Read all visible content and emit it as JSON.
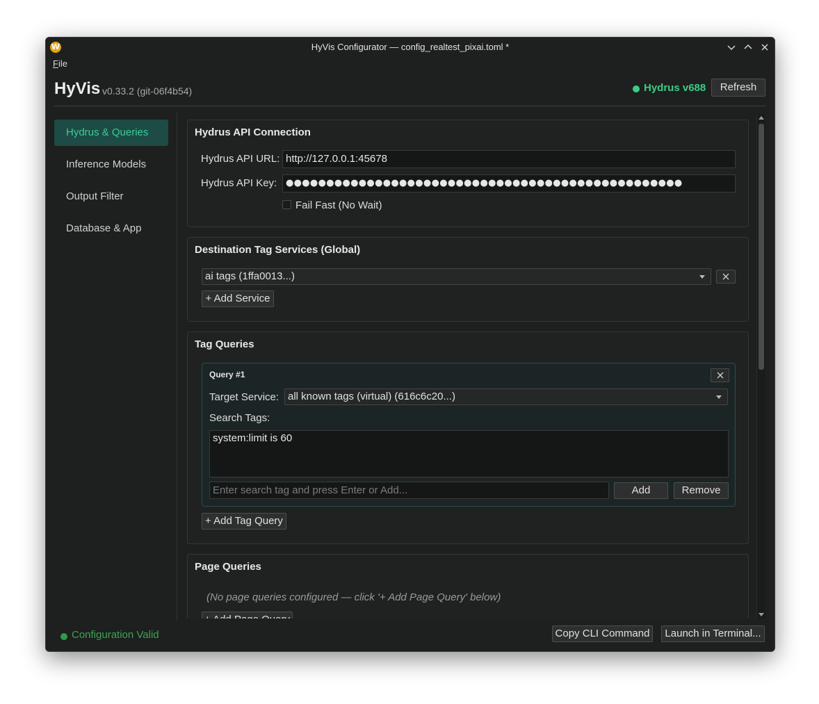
{
  "window": {
    "title": "HyVis Configurator — config_realtest_pixai.toml *",
    "app_icon_letter": "W"
  },
  "menubar": {
    "file_accel": "F",
    "file_rest": "ile"
  },
  "header": {
    "app_name": "HyVis",
    "version": "v0.33.2 (git-06f4b54)",
    "hydrus_status": "Hydrus v688",
    "refresh_label": "Refresh",
    "status_color": "#3dcc85"
  },
  "sidebar": {
    "items": [
      {
        "label": "Hydrus & Queries",
        "active": true
      },
      {
        "label": "Inference Models",
        "active": false
      },
      {
        "label": "Output Filter",
        "active": false
      },
      {
        "label": "Database & App",
        "active": false
      }
    ]
  },
  "api_connection": {
    "title": "Hydrus API Connection",
    "url_label": "Hydrus API URL:",
    "url_value": "http://127.0.0.1:45678",
    "key_label": "Hydrus API Key:",
    "key_value": "●●●●●●●●●●●●●●●●●●●●●●●●●●●●●●●●●●●●●●●●●●●●●●●●●",
    "fail_fast_label": "Fail Fast (No Wait)",
    "fail_fast_checked": false
  },
  "destination": {
    "title": "Destination Tag Services (Global)",
    "service_value": "ai tags  (1ffa0013...)",
    "add_service_label": "+ Add Service"
  },
  "tag_queries": {
    "title": "Tag Queries",
    "queries": [
      {
        "title": "Query #1",
        "target_label": "Target Service:",
        "target_value": "all known tags (virtual)  (616c6c20...)",
        "search_label": "Search Tags:",
        "tags": [
          "system:limit is 60"
        ],
        "input_placeholder": "Enter search tag and press Enter or Add...",
        "add_label": "Add",
        "remove_label": "Remove"
      }
    ],
    "add_query_label": "+ Add Tag Query"
  },
  "page_queries": {
    "title": "Page Queries",
    "empty_text": "(No page queries configured — click '+ Add Page Query' below)",
    "add_label": "+ Add Page Query"
  },
  "footer": {
    "status": "Configuration Valid",
    "copy_cli_label": "Copy CLI Command",
    "launch_label": "Launch in Terminal..."
  },
  "icons": {
    "close": "close-icon",
    "minimize": "chevron-down-icon",
    "maximize": "chevron-up-icon"
  }
}
